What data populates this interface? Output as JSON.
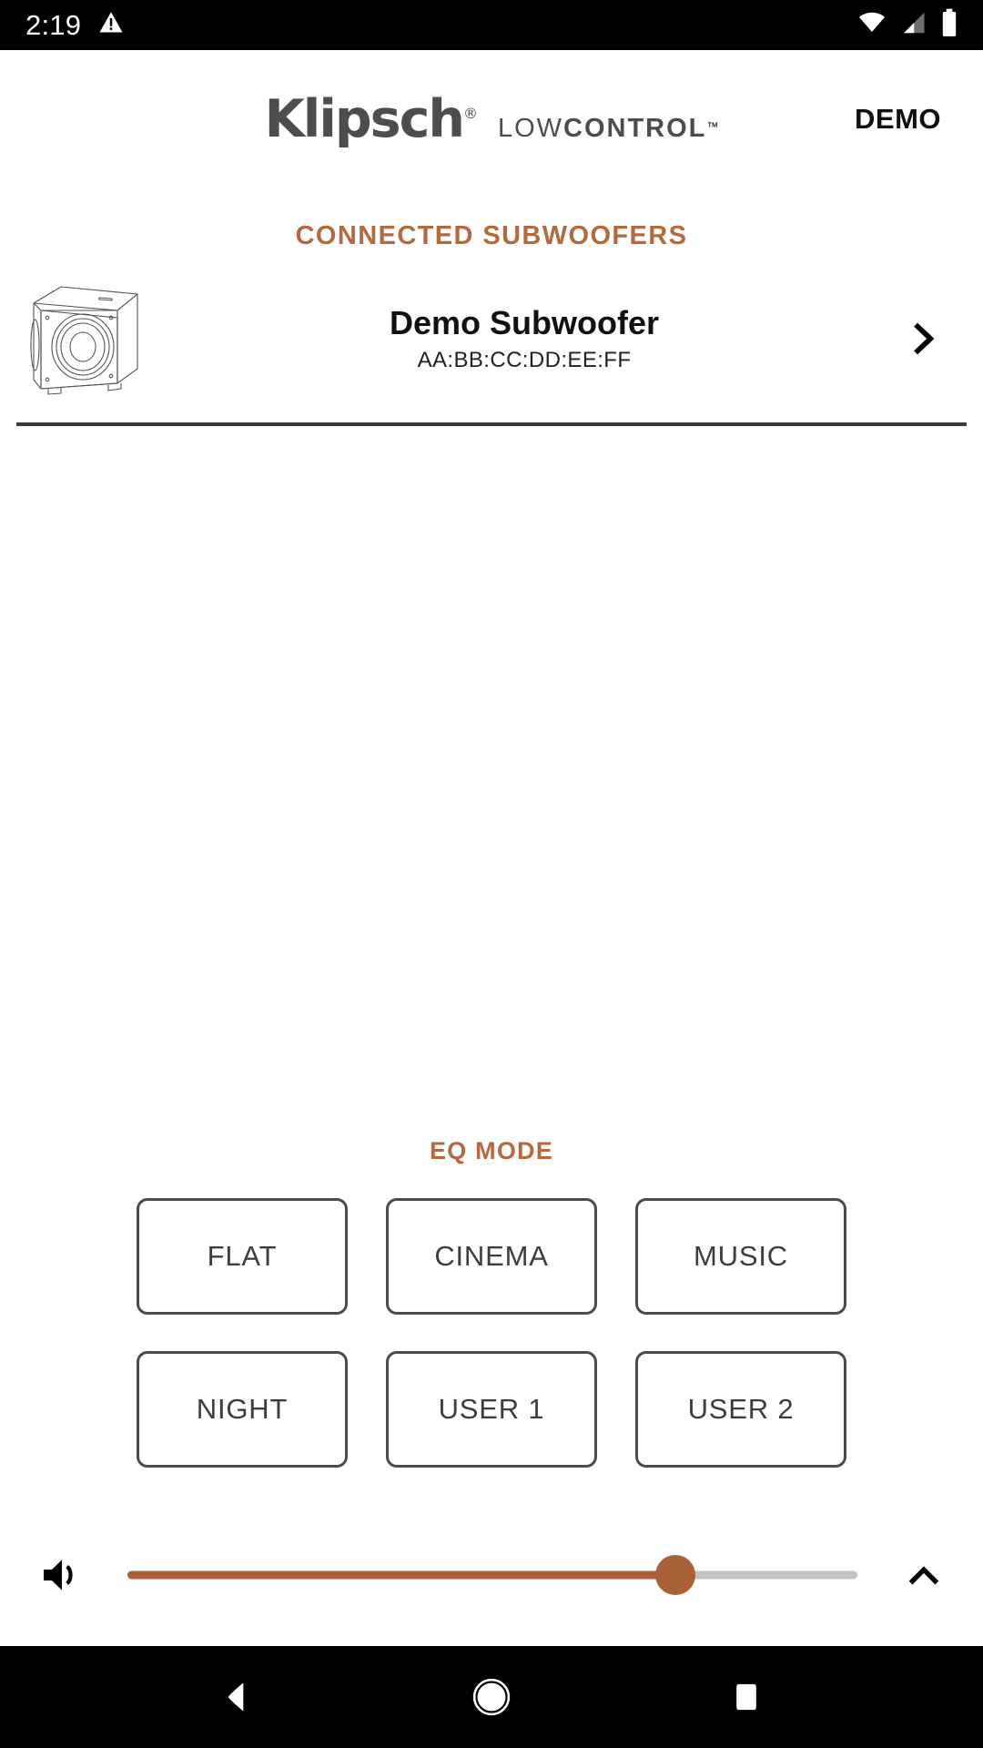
{
  "status_bar": {
    "clock": "2:19",
    "icons": [
      "warning-triangle-icon",
      "wifi-icon",
      "cellular-signal-icon",
      "battery-icon"
    ]
  },
  "header": {
    "brand": "Klipsch",
    "brand_registered": "®",
    "product_line_light": "LOW",
    "product_line_bold": "CONTROL",
    "product_line_tm": "™",
    "mode_label": "DEMO"
  },
  "connected": {
    "heading": "CONNECTED SUBWOOFERS",
    "devices": [
      {
        "name": "Demo Subwoofer",
        "mac": "AA:BB:CC:DD:EE:FF",
        "thumb": "subwoofer-illustration",
        "chevron": "chevron-right-icon"
      }
    ]
  },
  "eq": {
    "heading": "EQ MODE",
    "modes": [
      {
        "label": "FLAT",
        "selected": false
      },
      {
        "label": "CINEMA",
        "selected": false
      },
      {
        "label": "MUSIC",
        "selected": false
      },
      {
        "label": "NIGHT",
        "selected": false
      },
      {
        "label": "USER 1",
        "selected": false
      },
      {
        "label": "USER 2",
        "selected": false
      }
    ]
  },
  "volume": {
    "icon": "speaker-volume-icon",
    "expand_icon": "chevron-up-icon",
    "fill_percent": 75
  },
  "nav_bar": {
    "back": "back-triangle-icon",
    "home": "home-circle-icon",
    "recents": "recents-square-icon"
  },
  "colors": {
    "accent": "#b46a3f",
    "slider": "#ab6138",
    "slider_remaining": "#c2c2c2",
    "logo_gray": "#4d4d4d",
    "border_gray": "#4a4a4a",
    "divider": "#3a3a3a",
    "status_bar_bg": "#000000"
  }
}
